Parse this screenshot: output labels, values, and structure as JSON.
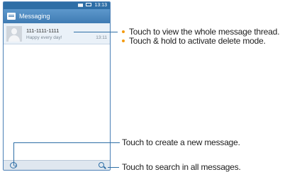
{
  "status_bar": {
    "time": "13:13",
    "signal": "▮▮▮"
  },
  "action_bar": {
    "title": "Messaging"
  },
  "threads": [
    {
      "name": "111-1111-1111",
      "snippet": "Happy every day!",
      "time": "13:11"
    }
  ],
  "bottom_bar": {
    "left_icon": "compose-icon",
    "right_icon": "search-icon"
  },
  "annotations": {
    "thread_bullets": [
      "Touch to view the whole message thread.",
      "Touch & hold to activate delete mode."
    ],
    "compose": "Touch to create a new message.",
    "search": "Touch to search in all messages."
  },
  "colors": {
    "accent": "#2e6ea6",
    "bullet": "#f39c12"
  }
}
